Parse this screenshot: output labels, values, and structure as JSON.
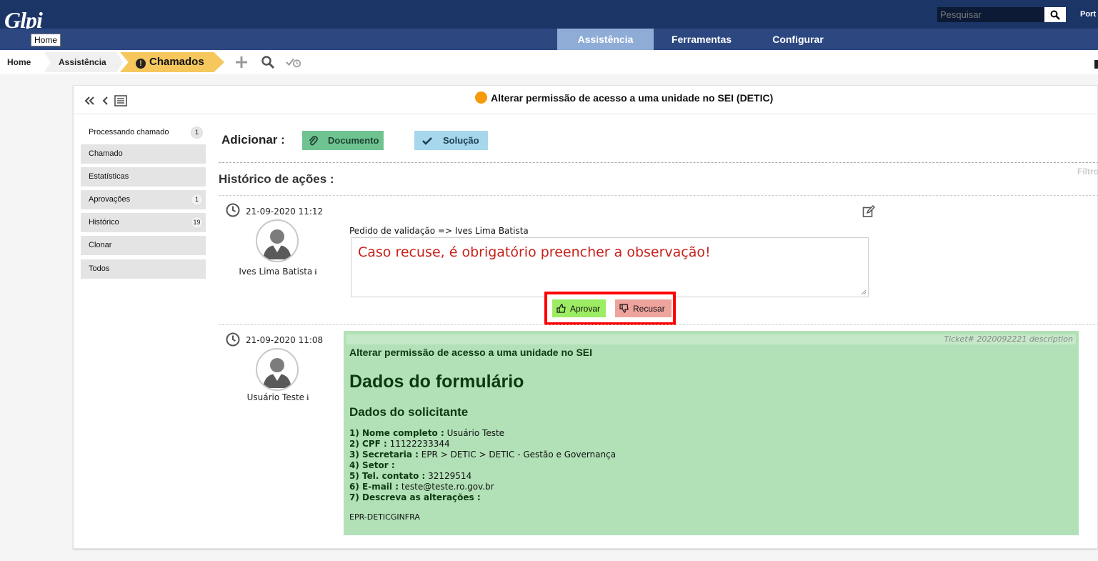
{
  "header": {
    "logo_text": "Glpi",
    "logo_tooltip": "Home",
    "search_placeholder": "Pesquisar",
    "language": "Port"
  },
  "nav": {
    "tabs": [
      {
        "label": "Assistência",
        "active": true
      },
      {
        "label": "Ferramentas",
        "active": false
      },
      {
        "label": "Configurar",
        "active": false
      }
    ]
  },
  "breadcrumb": {
    "home": "Home",
    "assist": "Assistência",
    "current": "Chamados"
  },
  "ticket": {
    "title": "Alterar permissão de acesso a uma unidade no SEI (DETIC)",
    "status_color": "#f59a0c"
  },
  "sidebar": {
    "items": [
      {
        "label": "Processando chamado",
        "badge": "1"
      },
      {
        "label": "Chamado",
        "badge": ""
      },
      {
        "label": "Estatísticas",
        "badge": ""
      },
      {
        "label": "Aprovações",
        "badge": "1"
      },
      {
        "label": "Histórico",
        "badge": "19"
      },
      {
        "label": "Clonar",
        "badge": ""
      },
      {
        "label": "Todos",
        "badge": ""
      }
    ]
  },
  "content": {
    "add_label": "Adicionar :",
    "btn_document": "Documento",
    "btn_solution": "Solução",
    "filter": "Filtro",
    "history_title": "Histórico de ações :"
  },
  "validation": {
    "datetime": "21-09-2020 11:12",
    "user": "Ives Lima Batista",
    "label": "Pedido de validação => Ives Lima Batista",
    "observation": "Caso recuse, é obrigatório preencher a observação!",
    "approve": "Aprovar",
    "refuse": "Recusar"
  },
  "description": {
    "datetime": "21-09-2020 11:08",
    "user": "Usuário Teste",
    "ticket_ref": "Ticket# 2020092221 description",
    "subtitle": "Alterar permissão de acesso a uma unidade no SEI",
    "heading1": "Dados do formulário",
    "heading2": "Dados do solicitante",
    "fields": [
      {
        "label": "1) Nome completo :",
        "value": "Usuário Teste"
      },
      {
        "label": "2) CPF :",
        "value": "11122233344"
      },
      {
        "label": "3) Secretaria :",
        "value": "EPR > DETIC > DETIC - Gestão e Governança"
      },
      {
        "label": "4) Setor :",
        "value": ""
      },
      {
        "label": "5) Tel. contato :",
        "value": "32129514"
      },
      {
        "label": "6) E-mail :",
        "value": "teste@teste.ro.gov.br"
      },
      {
        "label": "7) Descreva as alterações :",
        "value": ""
      }
    ],
    "footer": "EPR-DETICGINFRA"
  },
  "colors": {
    "header_bg": "#1c3567",
    "nav_bg": "#2d4780",
    "nav_active": "#8eacd6",
    "crumb_current": "#f6c75d",
    "doc_btn": "#6fc391",
    "sol_btn": "#a6d7ec",
    "approve_btn": "#9ded64",
    "refuse_btn": "#eea49d",
    "description_bg": "#b2e1b8",
    "highlight": "#ff0000"
  }
}
